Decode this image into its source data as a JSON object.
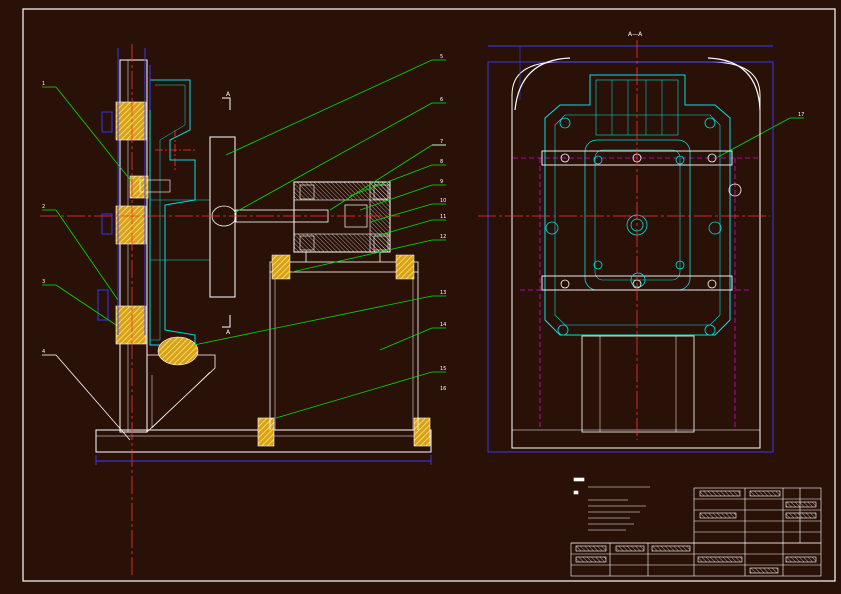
{
  "section_label_top": "A—A",
  "section_mark_upper": "A",
  "section_mark_lower": "A",
  "leaders_left": [
    {
      "id": "L1",
      "text": "1"
    },
    {
      "id": "L2",
      "text": "2"
    },
    {
      "id": "L3",
      "text": "3"
    },
    {
      "id": "L4",
      "text": "4"
    }
  ],
  "leaders_right": [
    {
      "id": "R1",
      "text": "5"
    },
    {
      "id": "R2",
      "text": "6"
    },
    {
      "id": "R3",
      "text": "7"
    },
    {
      "id": "R4",
      "text": "8"
    },
    {
      "id": "R5",
      "text": "9"
    },
    {
      "id": "R6",
      "text": "10"
    },
    {
      "id": "R7",
      "text": "11"
    },
    {
      "id": "R8",
      "text": "12"
    },
    {
      "id": "R9",
      "text": "13"
    },
    {
      "id": "R10",
      "text": "14"
    },
    {
      "id": "R11",
      "text": "15"
    },
    {
      "id": "R12",
      "text": "16"
    }
  ],
  "leader_section_view": "17",
  "colors": {
    "background": "#2a1108",
    "frame": "#ffffff",
    "outline": "#00e0e0",
    "center_line": "#ff3030",
    "hatch": "#e8e800",
    "leader": "#00e000",
    "dimension": "#3a3aff",
    "hidden": "#e000e0"
  }
}
